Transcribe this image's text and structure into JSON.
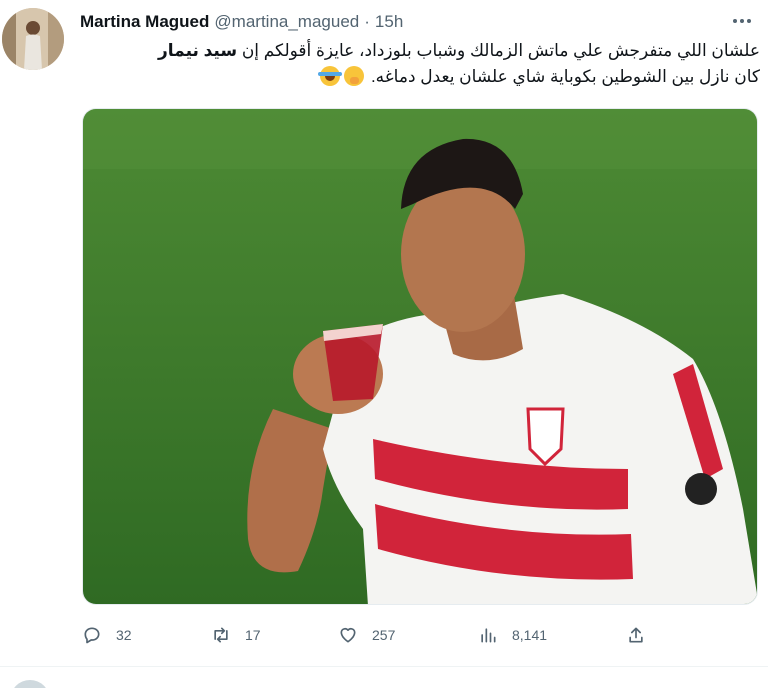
{
  "tweet": {
    "author": {
      "display_name": "Martina Magued",
      "handle": "@martina_magued",
      "time": "15h"
    },
    "text": {
      "line1_before": "علشان اللي متفرجش علي ماتش الزمالك وشباب بلوزداد، عايزة أقولكم إن ",
      "line1_bold": "سيد نيمار",
      "line2": "كان نازل بين الشوطين بكوباية شاي علشان يعدل دماغه."
    },
    "actions": {
      "replies": "32",
      "retweets": "17",
      "likes": "257",
      "views": "8,141"
    },
    "icons": [
      "more-icon",
      "reply-icon",
      "retweet-icon",
      "like-icon",
      "views-icon",
      "share-icon"
    ],
    "colors": {
      "accent": "#1d9bf0",
      "muted": "#536471",
      "jersey_stripe": "#d1243a",
      "pitch": "#3f7a2c"
    }
  }
}
